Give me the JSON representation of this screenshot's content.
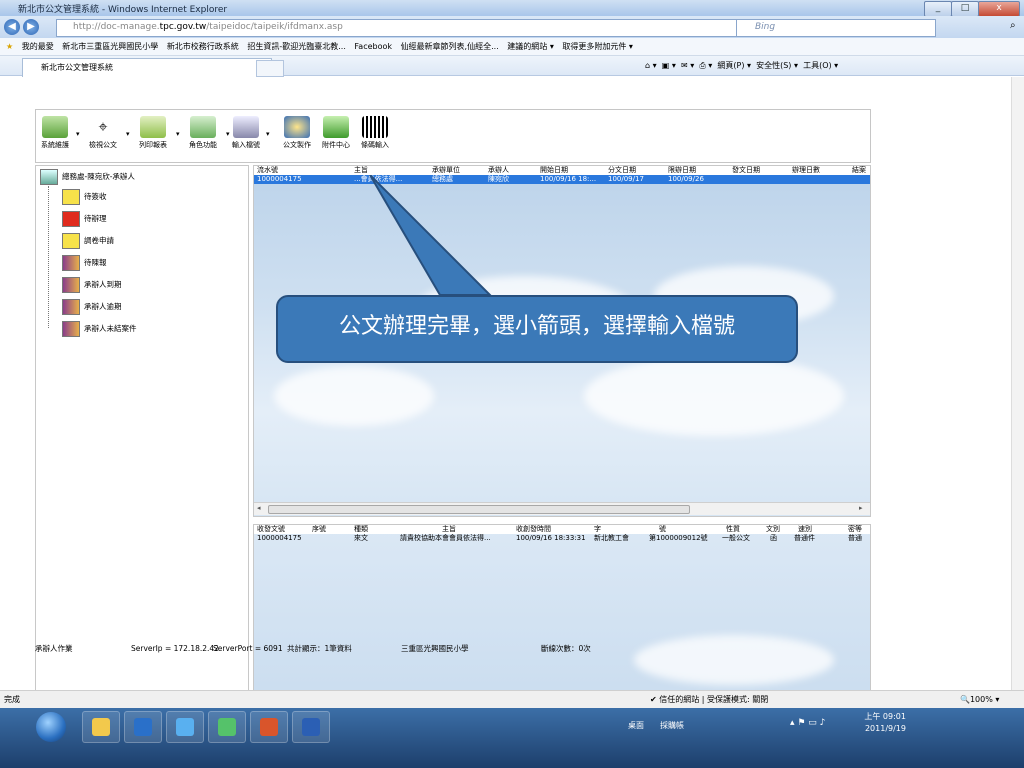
{
  "window": {
    "title": "新北市公文管理系統 - Windows Internet Explorer",
    "min": "_",
    "max": "□",
    "close": "x"
  },
  "address": {
    "url_dim": "http://doc-manage.",
    "url_host": "tpc.gov.tw",
    "url_path": "/taipeidoc/taipeik/ifdmanx.asp",
    "search_placeholder": "Bing"
  },
  "favorites": {
    "label": "我的最愛",
    "items": [
      "新北市三重區光興國民小學",
      "新北市校務行政系統",
      "招生資訊-歡迎光臨臺北教...",
      "Facebook",
      "仙經最新章節列表,仙經全...",
      "建議的網站 ▾",
      "取得更多附加元件 ▾"
    ]
  },
  "tab": {
    "title": "新北市公文管理系統"
  },
  "commands": {
    "page": "網頁(P) ▾",
    "safety": "安全性(S) ▾",
    "tools": "工具(O) ▾"
  },
  "toolbar": {
    "buttons": [
      {
        "label": "系統維護"
      },
      {
        "label": "檢視公文"
      },
      {
        "label": "列印報表"
      },
      {
        "label": "角色功能"
      },
      {
        "label": "輸入檔號"
      },
      {
        "label": "公文製作"
      },
      {
        "label": "附件中心"
      },
      {
        "label": "條碼輸入"
      }
    ]
  },
  "tree": {
    "root": "總務處-陳宛欣-承辦人",
    "items": [
      "待簽收",
      "待辦理",
      "調卷申請",
      "待陳報",
      "承辦人到期",
      "承辦人逾期",
      "承辦人未結案件"
    ]
  },
  "main_grid": {
    "headers": [
      "流水號",
      "主旨",
      "承辦單位",
      "承辦人",
      "開始日期",
      "分文日期",
      "限辦日期",
      "發文日期",
      "辦理日數",
      "結案"
    ],
    "row": [
      "1000004175",
      "...會員依法得...",
      "總務處",
      "陳宛欣",
      "100/09/16 18:...",
      "100/09/17",
      "100/09/26",
      "",
      "",
      ""
    ]
  },
  "callout": {
    "text": "公文辦理完畢，選小箭頭，選擇輸入檔號"
  },
  "lower_grid": {
    "headers": [
      "收發文號",
      "序號",
      "種類",
      "主旨",
      "收創發時間",
      "字",
      "號",
      "性質",
      "文別",
      "速別",
      "密等"
    ],
    "row": [
      "1000004175",
      "",
      "來文",
      "請貴校協助本會會員依法得...",
      "100/09/16 18:33:31",
      "新北教工會",
      "第1000009012號",
      "一般公文",
      "函",
      "普通件",
      "普通"
    ]
  },
  "page_status": {
    "role": "承辦人作業",
    "server_ip": "ServerIp = 172.18.2.42",
    "server_port": "ServerPort = 6091",
    "count": "共計顯示：1筆資料",
    "school": "三重區光興國民小學",
    "disconnects": "斷線次數：0次"
  },
  "ie_status": {
    "left": "完成",
    "zone": "✔ 信任的網站 | 受保護模式: 關閉",
    "zoom": "🔍100% ▾"
  },
  "taskbar": {
    "desktop": "桌面",
    "folder": "採購帳",
    "time": "上午 09:01",
    "date": "2011/9/19"
  }
}
